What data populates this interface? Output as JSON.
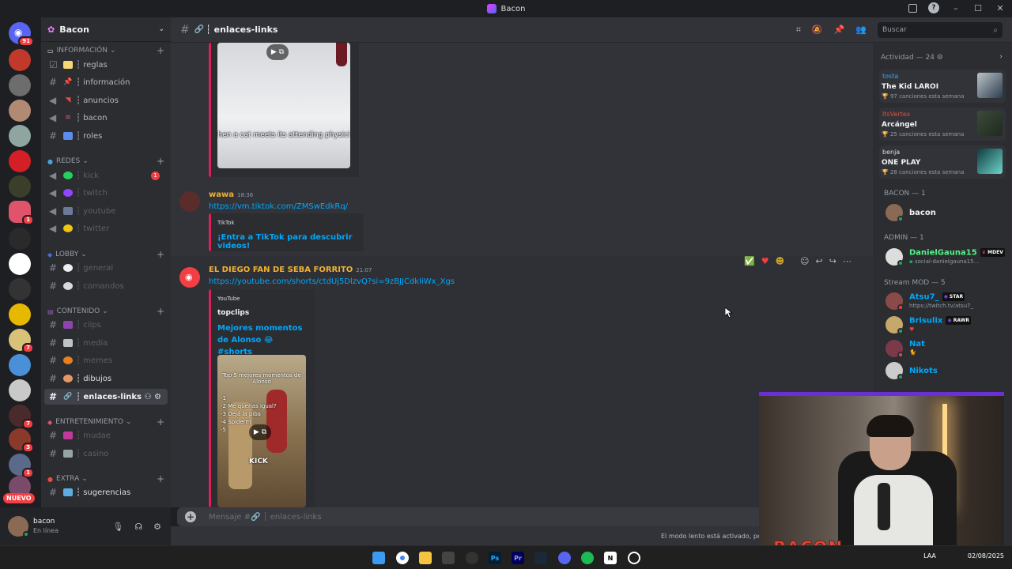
{
  "window": {
    "title": "Bacon"
  },
  "rail": {
    "home_badge": "91",
    "new_label": "NUEVO",
    "badges": [
      "1",
      "7",
      "7",
      "3",
      "1"
    ]
  },
  "guild": {
    "name": "Bacon"
  },
  "categories": {
    "info": "INFORMACIÓN",
    "redes": "REDES",
    "lobby": "LOBBY",
    "contenido": "CONTENIDO",
    "entretenimiento": "ENTRETENIMIENTO",
    "extra": "EXTRA"
  },
  "channels": {
    "reglas": "┆ reglas",
    "informacion": "┆ información",
    "anuncios": "┆ anuncios",
    "bacon": "┆ bacon",
    "roles": "┆ roles",
    "kick": "┆ kick",
    "kick_badge": "1",
    "twitch": "┆ twitch",
    "youtube": "┆ youtube",
    "twitter": "┆ twitter",
    "general": "┆ general",
    "comandos": "┆ comandos",
    "clips": "┆ clips",
    "media": "┆ media",
    "memes": "┆ memes",
    "dibujos": "┆ dibujos",
    "enlaces": "┆ enlaces-links",
    "mudae": "┆ mudae",
    "casino": "┆ casino",
    "sugerencias": "┆ sugerencias"
  },
  "user": {
    "name": "bacon",
    "status": "En línea"
  },
  "header": {
    "channel": "┆ enlaces-links",
    "search_placeholder": "Buscar"
  },
  "messages": {
    "m0": {
      "caption": "hen a cat meets its attending physici"
    },
    "m1": {
      "author": "wawa",
      "time": "18:36",
      "link": "https://vm.tiktok.com/ZMSwEdkRq/",
      "embed_provider": "TikTok",
      "embed_title": "¡Entra a TikTok para descubrir videos!"
    },
    "m2": {
      "author": "EL DIEGO FAN DE SEBA FORRITO",
      "time": "21:07",
      "link": "https://youtube.com/shorts/ctdUj5DlzvQ?si=9zBJJCdkIiWx_Xgs",
      "embed_provider": "YouTube",
      "embed_author": "topclips",
      "embed_title": "Mejores momentos de Alonso 😂 #shorts",
      "thumb_title": "Top 5 mejores momentos de Alonso",
      "thumb_items": [
        "-1",
        "-2 Me querias igual?",
        "-3 Dejá la piba",
        "-4 Spiderm",
        "-5"
      ],
      "thumb_brand": "KICK"
    }
  },
  "composer": {
    "placeholder": "Mensaje #🔗 ┆ enlaces-links",
    "slowmode": "El modo lento está activado, pe"
  },
  "activity": {
    "header": "Actividad — 24",
    "cards": [
      {
        "user": "tosta",
        "song": "The Kid LAROI",
        "count": "97 canciones esta semana"
      },
      {
        "user": "ItsVertex",
        "song": "Arcángel",
        "count": "25 canciones esta semana"
      },
      {
        "user": "benja",
        "song": "ONE PLAY",
        "count": "28 canciones esta semana"
      }
    ]
  },
  "roles": {
    "bacon": {
      "header": "BACON — 1",
      "members": [
        {
          "name": "bacon"
        }
      ]
    },
    "admin": {
      "header": "ADMIN — 1",
      "members": [
        {
          "name": "DanielGauna15",
          "tag": "MDEV",
          "sub": "social-danielgauna15..."
        }
      ]
    },
    "mod": {
      "header": "Stream MOD — 5",
      "members": [
        {
          "name": "Atsu7_",
          "tag": "STAR",
          "sub": "https://twitch.tv/atsu7_"
        },
        {
          "name": "Brisulix",
          "tag": "RAWR",
          "sub": "♥"
        },
        {
          "name": "Nat",
          "sub": ""
        },
        {
          "name": "Nikots",
          "sub": ""
        }
      ]
    }
  },
  "webcam": {
    "brand": "BACON"
  },
  "taskbar": {
    "lang": "LAA",
    "date": "02/08/2025"
  },
  "colors": {
    "accent": "#5865f2",
    "embed_bar": "#e01e5a",
    "link": "#00a8fc",
    "online": "#23a55a",
    "webcam_border": "#6b2fd6"
  }
}
